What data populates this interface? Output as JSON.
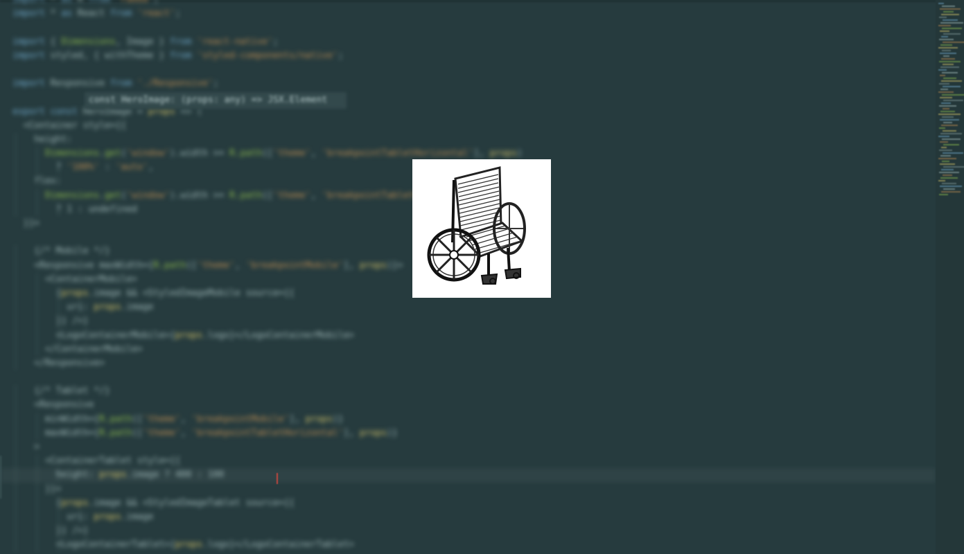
{
  "editor": {
    "theme": {
      "background": "#263b3e",
      "keyword": "#6fa7c9",
      "string": "#b88a52",
      "function": "#8cb84e",
      "variable": "#d1c16a",
      "cursor": "#c2473f"
    },
    "code_lines": [
      "import * as R from 'ramda';",
      "import * as React from 'react';",
      "",
      "import { Dimensions, Image } from 'react-native';",
      "import styled, { withTheme } from 'styled-components/native';",
      "",
      "import Responsive from './Responsive';",
      "",
      "export const HeroImage = props => (",
      "  <Container style={{",
      "    height:",
      "      Dimensions.get('window').width >= R.path(['theme', 'breakpointTabletHorizontal'], props)",
      "        ? '100%' : 'auto',",
      "    flex:",
      "      Dimensions.get('window').width >= R.path(['theme', 'breakpointTabletHorizontal'], props)",
      "        ? 1 : undefined",
      "  }}>",
      "",
      "    {/* Mobile */}",
      "    <Responsive maxWidth={R.path(['theme', 'breakpointMobile'], props)}>",
      "      <ContainerMobile>",
      "        {props.image && <StyledImageMobile source={{",
      "          uri: props.image",
      "        }} />}",
      "        <LogoContainerMobile>{props.logo}</LogoContainerMobile>",
      "      </ContainerMobile>",
      "    </Responsive>",
      "",
      "    {/* Tablet */}",
      "    <Responsive",
      "      minWidth={R.path(['theme', 'breakpointMobile'], props)}",
      "      maxWidth={R.path(['theme', 'breakpointTabletHorizontal'], props)}",
      "    >",
      "      <ContainerTablet style={{",
      "        height: props.image ? 400 : 100",
      "      }}>",
      "        {props.image && <StyledImageTablet source={{",
      "          uri: props.image",
      "        }} />}",
      "        <LogoContainerTablet>{props.logo}</LogoContainerTablet>"
    ],
    "tooltip": "const HeroImage: (props: any) => JSX.Element",
    "current_line_index": 34
  },
  "overlay": {
    "image_subject": "wheelchair-sketch",
    "image_background": "#ffffff"
  }
}
